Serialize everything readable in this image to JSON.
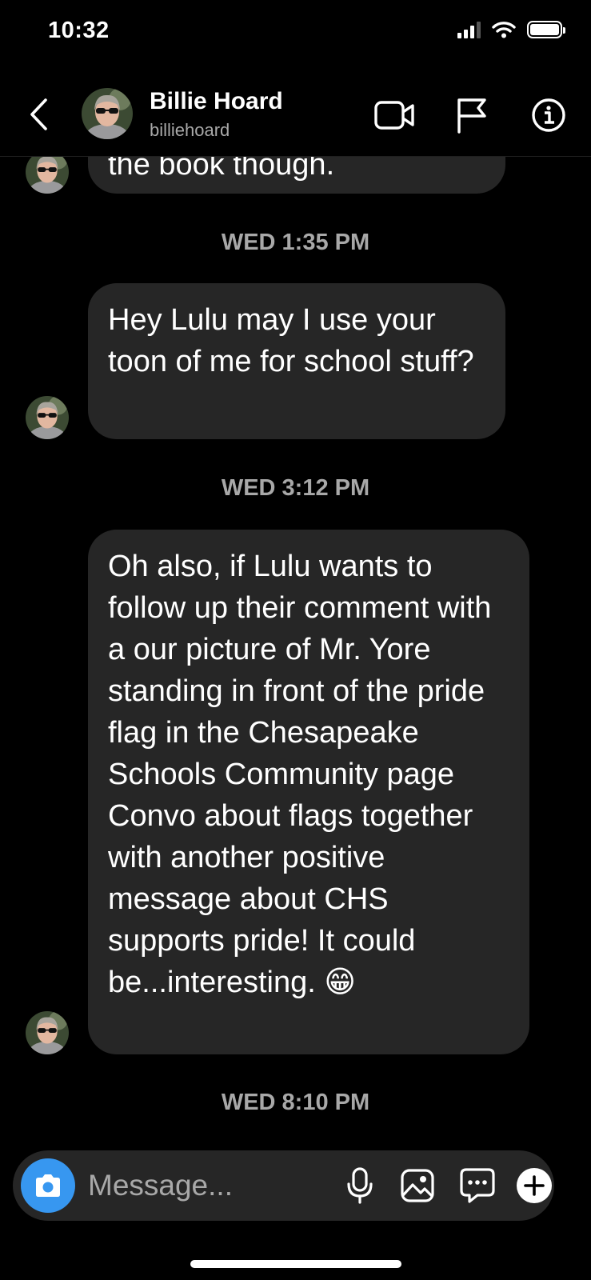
{
  "status_bar": {
    "time": "10:32",
    "icons": [
      "cellular-signal-icon",
      "wifi-icon",
      "battery-icon"
    ]
  },
  "header": {
    "back_icon": "chevron-left-icon",
    "contact_name": "Billie Hoard",
    "contact_handle": "billiehoard",
    "actions": [
      "video-call-icon",
      "flag-icon",
      "info-icon"
    ]
  },
  "thread": {
    "partial_message": "the book though.",
    "items": [
      {
        "timestamp": "WED 1:35 PM",
        "message": "Hey Lulu may I use your toon of me for school stuff?"
      },
      {
        "timestamp": "WED 3:12 PM",
        "message": "Oh also, if Lulu wants to follow up their comment with a our picture of Mr. Yore standing in front of the pride flag in the Chesapeake Schools Community page Convo about flags together with another positive message about CHS supports pride! It could be...interesting. 😁"
      },
      {
        "timestamp": "WED 8:10 PM"
      }
    ]
  },
  "composer": {
    "placeholder": "Message...",
    "icons": [
      "camera-icon",
      "microphone-icon",
      "gallery-icon",
      "sticker-icon",
      "plus-icon"
    ]
  },
  "colors": {
    "background": "#000000",
    "bubble": "#262626",
    "secondary_text": "#a8a8a8",
    "camera_button": "#3797f0"
  }
}
